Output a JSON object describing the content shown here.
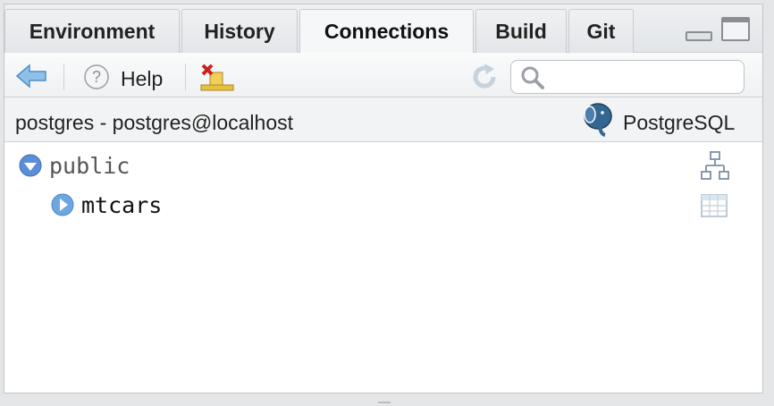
{
  "tabs": [
    {
      "label": "Environment",
      "active": false
    },
    {
      "label": "History",
      "active": false
    },
    {
      "label": "Connections",
      "active": true
    },
    {
      "label": "Build",
      "active": false
    },
    {
      "label": "Git",
      "active": false
    }
  ],
  "toolbar": {
    "back_icon": "arrow-left-icon",
    "help_label": "Help",
    "help_icon": "question-mark-icon",
    "disconnect_icon": "disconnect-icon",
    "refresh_icon": "refresh-icon",
    "search_placeholder": "",
    "search_icon": "search-icon"
  },
  "connection": {
    "title": "postgres - postgres@localhost",
    "type_label": "PostgreSQL",
    "type_icon": "postgresql-elephant-icon"
  },
  "tree": [
    {
      "label": "public",
      "kind": "schema",
      "expanded": true,
      "action_icon": "schema-tree-icon"
    },
    {
      "label": "mtcars",
      "kind": "table",
      "expanded": false,
      "action_icon": "table-grid-icon"
    }
  ],
  "colors": {
    "accent": "#5b8ed6",
    "tree_schema_text": "#555555",
    "tree_table_text": "#111111"
  }
}
